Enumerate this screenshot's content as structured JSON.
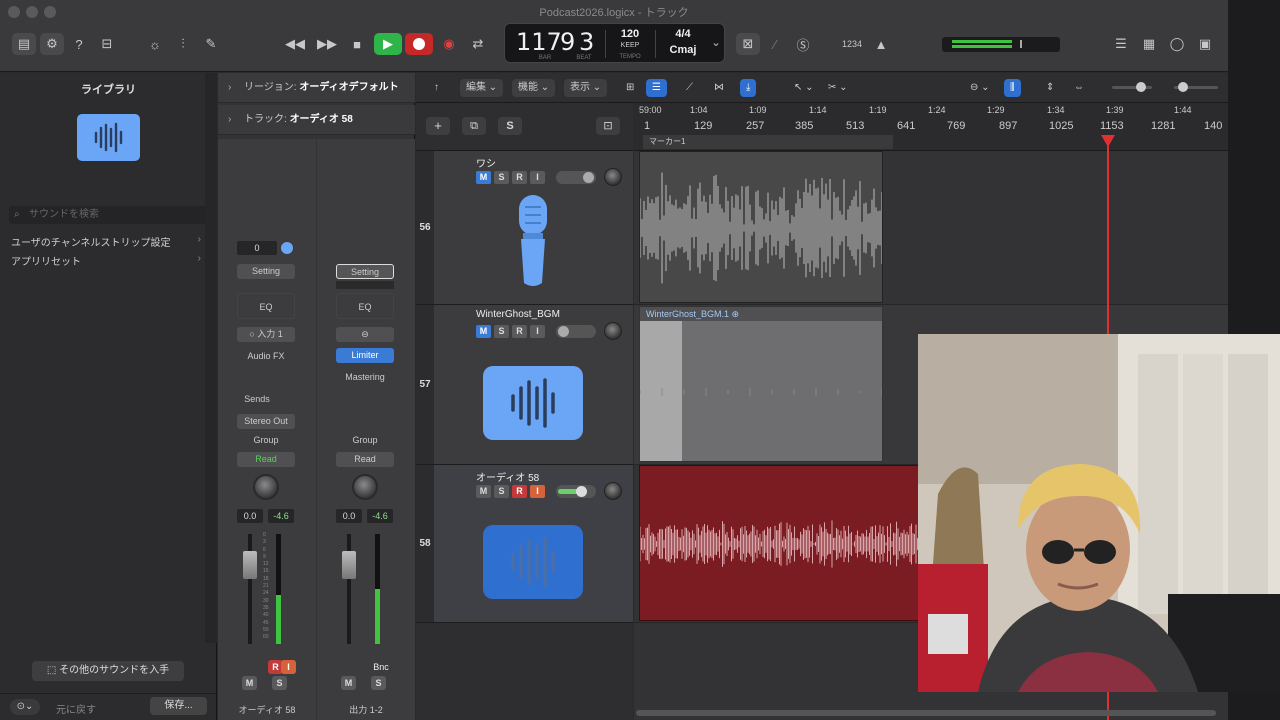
{
  "window": {
    "title": "Podcast2026.logicx - トラック"
  },
  "lcd": {
    "bar": "117",
    "beat": "9",
    "sub": "3",
    "bar_label": "BAR",
    "beat_label": "BEAT",
    "tempo": "120",
    "tempo_mode": "KEEP",
    "tempo_label": "TEMPO",
    "time_signature": "4/4",
    "key": "Cmaj"
  },
  "toolbar": {
    "count_in": "1234"
  },
  "library": {
    "title": "ライブラリ",
    "search_placeholder": "サウンドを検索",
    "items": [
      {
        "label": "ユーザのチャンネルストリップ設定"
      },
      {
        "label": "アプリリセット"
      }
    ],
    "more_sounds": "その他のサウンドを入手",
    "revert": "元に戻す",
    "save": "保存..."
  },
  "inspector": {
    "region_header_label": "リージョン:",
    "region_header_value": "オーディオデフォルト",
    "track_header_label": "トラック:",
    "track_header_value": "オーディオ 58",
    "strip1": {
      "gain": "0",
      "setting": "Setting",
      "eq": "EQ",
      "input": "入力 1",
      "audio_fx": "Audio FX",
      "sends": "Sends",
      "output": "Stereo Out",
      "group": "Group",
      "automation": "Read",
      "pan_value": "0.0",
      "peak": "-4.6",
      "name": "オーディオ 58",
      "meter_level": 0.45
    },
    "strip2": {
      "setting": "Setting",
      "eq": "EQ",
      "plugin": "Limiter",
      "mastering": "Mastering",
      "group": "Group",
      "automation": "Read",
      "pan_value": "0.0",
      "peak": "-4.6",
      "bnc": "Bnc",
      "name": "出力 1-2",
      "meter_level": 0.5
    },
    "scale": [
      "0",
      "3",
      "6",
      "9",
      "12",
      "15",
      "18",
      "21",
      "24",
      "30",
      "35",
      "40",
      "45",
      "50",
      "60"
    ],
    "ms_m": "M",
    "ms_s": "S",
    "ri_r": "R",
    "ri_i": "I"
  },
  "track_toolbar": {
    "edit": "編集",
    "function": "機能",
    "view": "表示",
    "new_track": "+",
    "s": "S"
  },
  "ruler": {
    "times": [
      "59:00",
      "1:04",
      "1:09",
      "1:14",
      "1:19",
      "1:24",
      "1:29",
      "1:34",
      "1:39",
      "1:44"
    ],
    "bars": [
      "1",
      "129",
      "257",
      "385",
      "513",
      "641",
      "769",
      "897",
      "1025",
      "1153",
      "1281",
      "140"
    ],
    "marker": "マーカー1"
  },
  "tracks": [
    {
      "number": "56",
      "name": "ワシ",
      "button_m": "M",
      "button_s": "S",
      "button_r": "R",
      "button_i": "I",
      "icon": "microphone-icon"
    },
    {
      "number": "57",
      "name": "WinterGhost_BGM",
      "button_m": "M",
      "button_s": "S",
      "button_r": "R",
      "button_i": "I",
      "icon": "waveform-icon"
    },
    {
      "number": "58",
      "name": "オーディオ 58",
      "button_m": "M",
      "button_s": "S",
      "button_r": "R",
      "button_i": "I",
      "icon": "waveform-icon"
    }
  ],
  "regions": {
    "bgm": "WinterGhost_BGM.1"
  },
  "colors": {
    "accent_blue": "#3a7bd5",
    "record_red": "#d63030",
    "play_green": "#2fb44a",
    "region_red": "#7a1c22"
  }
}
